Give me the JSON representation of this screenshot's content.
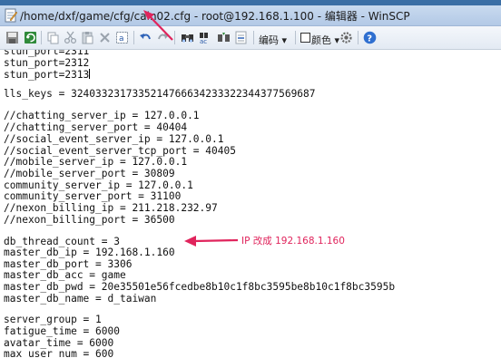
{
  "window": {
    "title": "/home/dxf/game/cfg/cain02.cfg - root@192.168.1.100 - 编辑器 - WinSCP"
  },
  "toolbar": {
    "encoding_label": "编码",
    "color_label": "颜色"
  },
  "icons": [
    "save-icon",
    "refresh-icon",
    "copy-icon",
    "cut-icon",
    "paste-icon",
    "delete-icon",
    "select-all-icon",
    "undo-icon",
    "redo-icon",
    "find-icon",
    "replace-icon",
    "find-next-icon",
    "goto-line-icon",
    "settings-icon",
    "help-icon"
  ],
  "editor": {
    "lines": [
      "stun_port=2311",
      "stun_port=2312",
      "stun_port=2313",
      "",
      "lls_keys = 324033231733521476663423332234437756968​7",
      "",
      "//chatting_server_ip = 127.0.0.1",
      "//chatting_server_port = 40404",
      "//social_event_server_ip = 127.0.0.1",
      "//social_event_server_tcp_port = 40405",
      "//mobile_server_ip = 127.0.0.1",
      "//mobile_server_port = 30809",
      "community_server_ip = 127.0.0.1",
      "community_server_port = 31100",
      "//nexon_billing_ip = 211.218.232.97",
      "//nexon_billing_port = 36500",
      "",
      "db_thread_count = 3",
      "master_db_ip = 192.168.1.160",
      "master_db_port = 3306",
      "master_db_acc = game",
      "master_db_pwd = 20e35501e56fcedbe8b10c1f8bc3595be8b10c1f8bc3595b",
      "master_db_name = d_taiwan",
      "",
      "server_group = 1",
      "fatigue_time = 6000",
      "avatar_time = 6000",
      "max_user_num = 600"
    ]
  },
  "annotation": {
    "text": "IP 改成 192.168.1.160",
    "color": "#e0245c"
  },
  "colors": {
    "title_bar": "#b3c9e6",
    "annotation_red": "#e0245c"
  }
}
